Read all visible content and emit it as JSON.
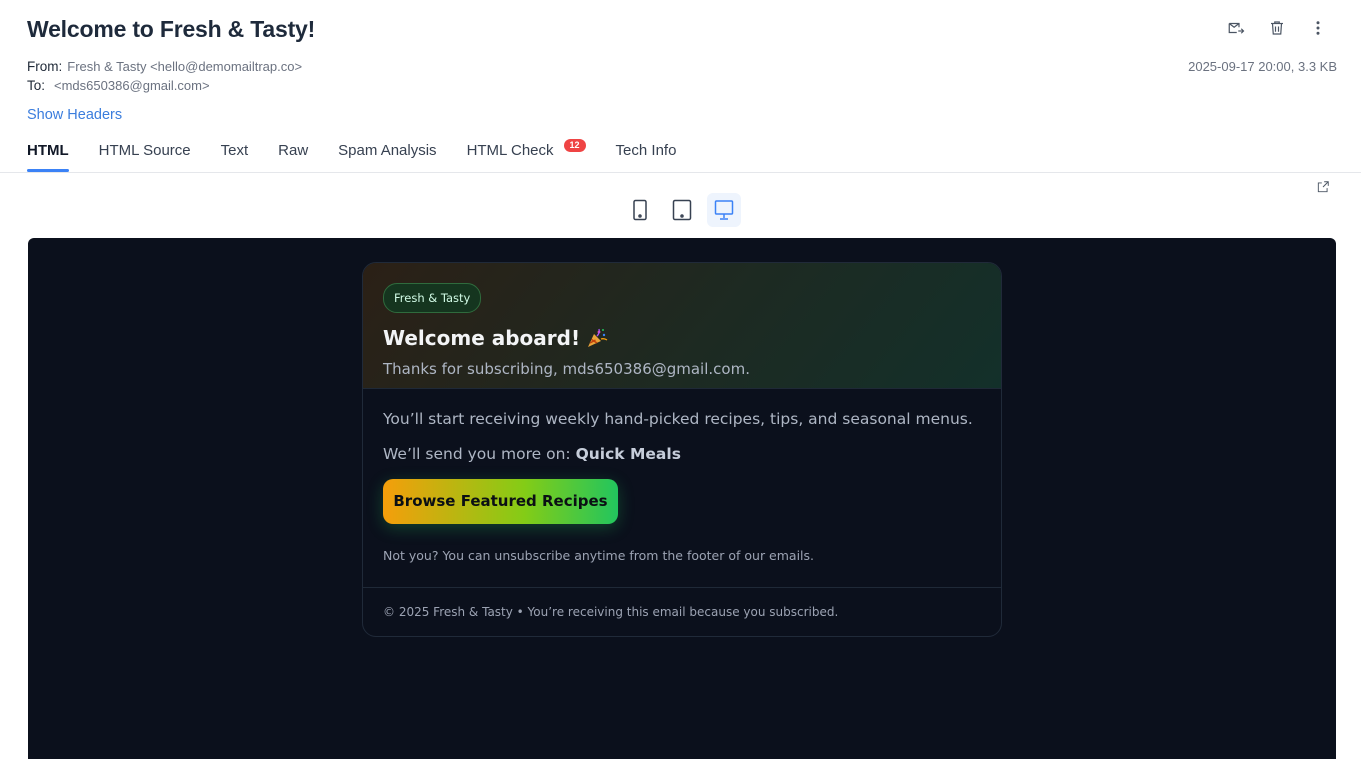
{
  "email": {
    "subject": "Welcome to Fresh & Tasty!",
    "from_label": "From:",
    "from_value": "Fresh & Tasty <hello@demomailtrap.co>",
    "to_label": "To:",
    "to_value": "<mds650386@gmail.com>",
    "date_size": "2025-09-17 20:00, 3.3 KB",
    "show_headers": "Show Headers"
  },
  "actions": [
    {
      "name": "forward-icon"
    },
    {
      "name": "trash-icon"
    },
    {
      "name": "more-vertical-icon"
    }
  ],
  "tabs": [
    {
      "label": "HTML",
      "active": true
    },
    {
      "label": "HTML Source"
    },
    {
      "label": "Text"
    },
    {
      "label": "Raw"
    },
    {
      "label": "Spam Analysis"
    },
    {
      "label": "HTML Check",
      "badge": "12"
    },
    {
      "label": "Tech Info"
    }
  ],
  "devices": [
    {
      "name": "mobile-icon",
      "active": false
    },
    {
      "name": "tablet-icon",
      "active": false
    },
    {
      "name": "desktop-icon",
      "active": true
    }
  ],
  "preview": {
    "brand": "Fresh & Tasty",
    "headline": "Welcome aboard!",
    "thanks": "Thanks for subscribing, mds650386@gmail.com.",
    "intro": "You’ll start receiving weekly hand-picked recipes, tips, and seasonal menus.",
    "interest_prefix": "We’ll send you more on:",
    "interest": "Quick Meals",
    "cta": "Browse Featured Recipes",
    "note": "Not you? You can unsubscribe anytime from the footer of our emails.",
    "footer": "© 2025 Fresh & Tasty • You’re receiving this email because you subscribed."
  },
  "colors": {
    "accent": "#3b82f6",
    "badge": "#ef4444",
    "preview_bg": "#0b101c"
  }
}
